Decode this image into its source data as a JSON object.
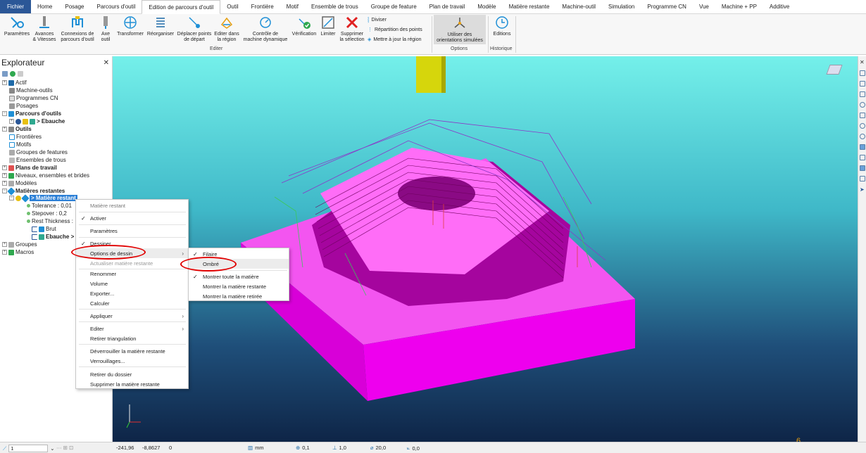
{
  "tabs": [
    "Fichier",
    "Home",
    "Posage",
    "Parcours d'outil",
    "Edition de parcours d'outil",
    "Outil",
    "Frontière",
    "Motif",
    "Ensemble de trous",
    "Groupe de feature",
    "Plan de travail",
    "Modèle",
    "Matière restante",
    "Machine-outil",
    "Simulation",
    "Programme CN",
    "Vue",
    "Machine + PP",
    "Additive"
  ],
  "ribbon": {
    "params": "Paramètres",
    "avances": "Avances\n& Vitesses",
    "connexions": "Connexions de\nparcours d'outil",
    "axe": "Axe\noutil",
    "transformer": "Transformer",
    "reorganiser": "Réorganiser",
    "deplacer": "Déplacer points\nde départ",
    "editer_region": "Editer dans\nla région",
    "controle": "Contrôle de\nmachine dynamique",
    "verification": "Vérification",
    "limiter": "Limiter",
    "supprimer": "Supprimer\nla sélection",
    "diviser": "Diviser",
    "repartition": "Répartition des points",
    "mettre_jour": "Mettre à jour la région",
    "utiliser": "Utiliser des\norientations simulées",
    "editions": "Editions",
    "grp_editer": "Editer",
    "grp_options": "Options",
    "grp_historique": "Historique"
  },
  "explorer": {
    "title": "Explorateur",
    "items": [
      "Actif",
      "Machine-outils",
      "Programmes CN",
      "Posages",
      "Parcours d'outils",
      "> Ebauche",
      "Outils",
      "Frontières",
      "Motifs",
      "Groupes de features",
      "Ensembles de trous",
      "Plans de travail",
      "Niveaux, ensembles et brides",
      "Modèles",
      "Matières restantes",
      "> Matière restant",
      "Tolerance  : 0,01",
      "Stepover  : 0,2",
      "Rest Thickness :",
      "Brut",
      "Ebauche >",
      "Groupes",
      "Macros"
    ]
  },
  "context_menu": {
    "header": "Matière restant",
    "items": [
      "Activer",
      "Paramètres",
      "Dessiner",
      "Options de dessin",
      "Actualiser matière restante",
      "Renommer",
      "Volume",
      "Exporter...",
      "Calculer",
      "Appliquer",
      "Editer",
      "Retirer triangulation",
      "Déverrouiller la matière restante",
      "Verrouillages...",
      "Retirer du dossier",
      "Supprimer la matière restante"
    ]
  },
  "submenu": {
    "items": [
      "Filaire",
      "Ombré",
      "Montrer toute la matière",
      "Montrer la matière restante",
      "Montrer la matière retirée"
    ]
  },
  "viewport": {
    "corner_number": "6"
  },
  "status": {
    "field1": "1",
    "x": "-241,96",
    "y": "-8,8627",
    "z": "0",
    "units": "mm",
    "v1": "0,1",
    "v2": "1,0",
    "v3": "20,0",
    "v4": "0,0"
  },
  "colors": {
    "accent": "#2b5797",
    "stock": "#ff55ff",
    "highlight": "#e00000"
  }
}
